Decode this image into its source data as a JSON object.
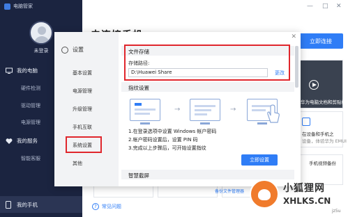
{
  "app": {
    "title": "电脑管家"
  },
  "sidebar": {
    "login": "未登录",
    "sections": [
      {
        "label": "我的电脑",
        "items": [
          "硬件检测",
          "驱动管理",
          "电源管理"
        ]
      },
      {
        "label": "我的服务",
        "items": [
          "智能客服"
        ]
      }
    ],
    "bottom": "我的手机"
  },
  "main": {
    "title": "未连接手机",
    "connect_button": "立即连接",
    "video_card": "华为电脑文档和剪贴板",
    "card2_line1": "在设备和手机之",
    "card2_line2": "设备，体验华为 EMUI",
    "card3_line1": "手机视频备份",
    "backup_link": "备份文件管理器",
    "faq": "常见问题"
  },
  "settings": {
    "title": "设置",
    "nav": [
      "基本设置",
      "电源管理",
      "升级管理",
      "手机互联",
      "系统设置",
      "其他"
    ],
    "selected_index": 4,
    "file_storage": {
      "heading": "文件存储",
      "label": "存储路径:",
      "path": "D:\\Huawei Share",
      "change": "更改"
    },
    "fingerprint": {
      "heading": "指纹设置",
      "steps": [
        "1.在登录选项中设置 Windows 帐户密码",
        "2.帐户密码设置后，设置 PIN 码",
        "3.完成以上步骤后，可开始设置指纹"
      ],
      "button": "立即设置"
    },
    "smart_screen": {
      "heading": "智慧截屏"
    }
  },
  "watermark": {
    "brand": "小狐狸网",
    "domain": "XHLKS.CN",
    "tag": "jz5u"
  }
}
